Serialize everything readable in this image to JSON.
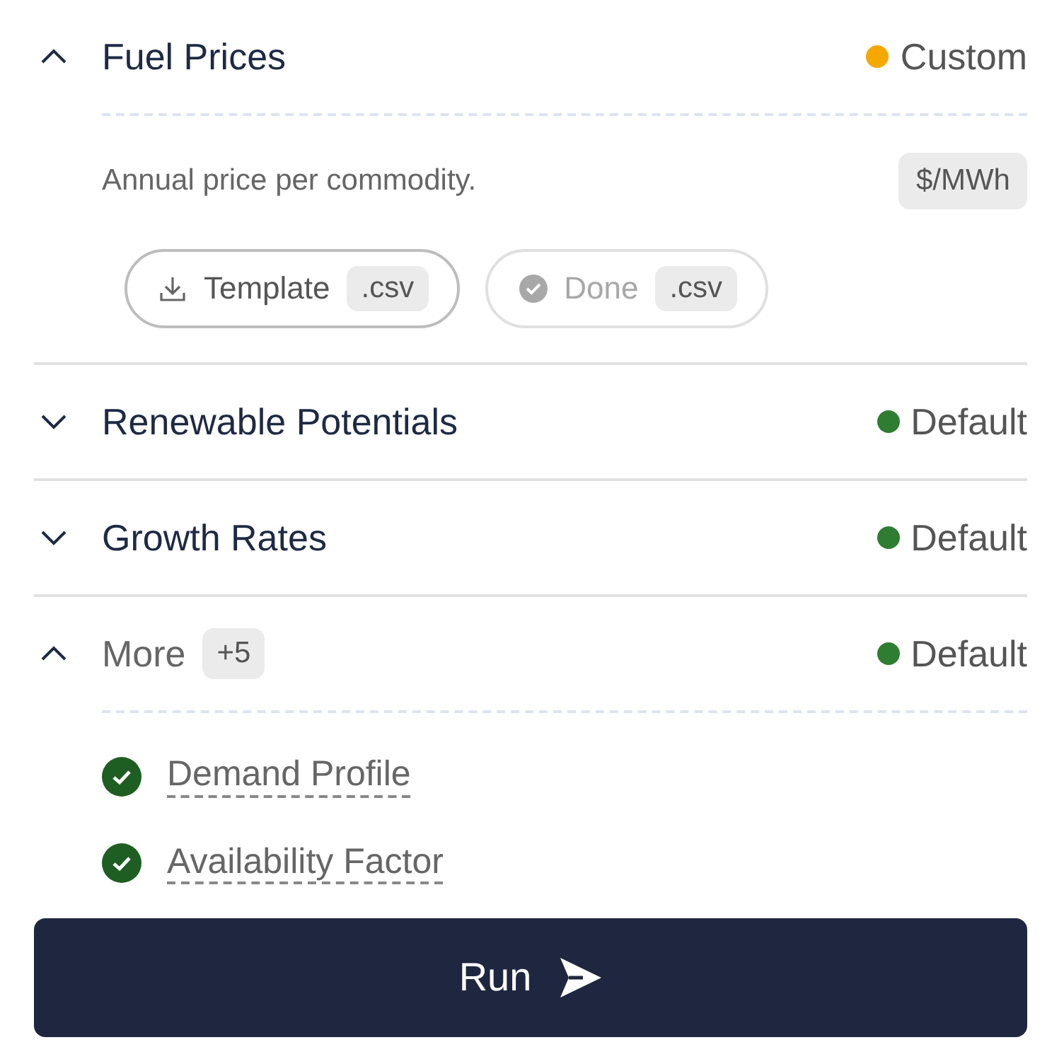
{
  "sections": [
    {
      "kind": "input",
      "title": "Fuel Prices",
      "expanded": true,
      "status": {
        "label": "Custom",
        "color": "#f5a800"
      },
      "description": "Annual price per commodity.",
      "unit": "$/MWh",
      "actions": [
        {
          "kind": "download",
          "label": "Template",
          "ext": ".csv",
          "disabled": false
        },
        {
          "kind": "done",
          "label": "Done",
          "ext": ".csv",
          "disabled": true
        }
      ]
    },
    {
      "kind": "input",
      "title": "Renewable Potentials",
      "expanded": false,
      "status": {
        "label": "Default",
        "color": "#2e7d32"
      }
    },
    {
      "kind": "input",
      "title": "Growth Rates",
      "expanded": false,
      "status": {
        "label": "Default",
        "color": "#2e7d32"
      }
    },
    {
      "kind": "group",
      "title": "More",
      "badge": "+5",
      "expanded": true,
      "status": {
        "label": "Default",
        "color": "#2e7d32"
      },
      "items": [
        {
          "label": "Demand Profile",
          "checked": true
        },
        {
          "label": "Availability Factor",
          "checked": true
        }
      ]
    }
  ],
  "run_button": {
    "label": "Run"
  }
}
